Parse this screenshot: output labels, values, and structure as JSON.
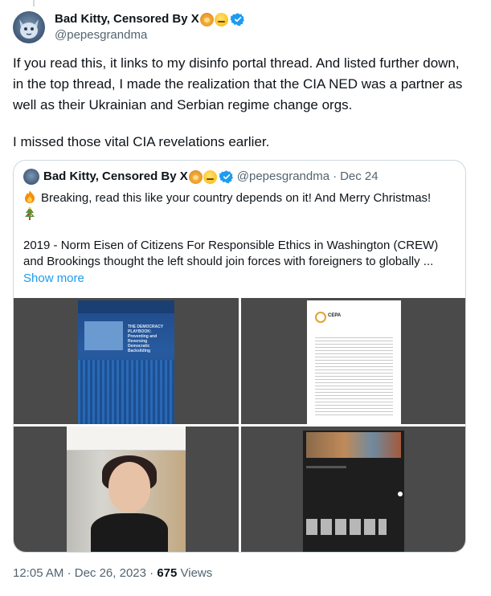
{
  "author": {
    "display_name": "Bad Kitty, Censored By X",
    "emojis": [
      "lion-face-emoji",
      "zipper-mouth-emoji"
    ],
    "handle": "@pepesgrandma",
    "verified": true
  },
  "tweet": {
    "paragraph_1": "If you read this, it links to my disinfo portal thread. And listed further down, in the top thread, I made the realization that the CIA NED was a partner as well as their Ukrainian and Serbian regime change orgs.",
    "paragraph_2": "I missed those vital CIA revelations earlier."
  },
  "quote": {
    "display_name": "Bad Kitty, Censored By X",
    "handle": "@pepesgrandma",
    "separator": "·",
    "date": "Dec 24",
    "line_1": "Breaking, read this like your country depends on it! And Merry Christmas!",
    "body": "2019 - Norm Eisen of Citizens For Responsible Ethics in Washington (CREW) and Brookings thought the left should join forces with foreigners to globally ...",
    "show_more": "Show more",
    "media": [
      {
        "name": "book-cover-image",
        "cover_title": "THE DEMOCRACY PLAYBOOK: Preventing and Reversing Democratic Backsliding"
      },
      {
        "name": "cepa-document-image",
        "logo_text": "CEPA"
      },
      {
        "name": "portrait-photo-image"
      },
      {
        "name": "website-screenshot-image"
      }
    ]
  },
  "footer": {
    "time": "12:05 AM",
    "separator": "·",
    "date": "Dec 26, 2023",
    "separator_2": "·",
    "views_count": "675",
    "views_label": "Views"
  },
  "colors": {
    "text": "#0f1419",
    "secondary": "#536471",
    "link": "#1d9bf0",
    "border": "#cfd9de",
    "verified": "#1d9bf0"
  }
}
